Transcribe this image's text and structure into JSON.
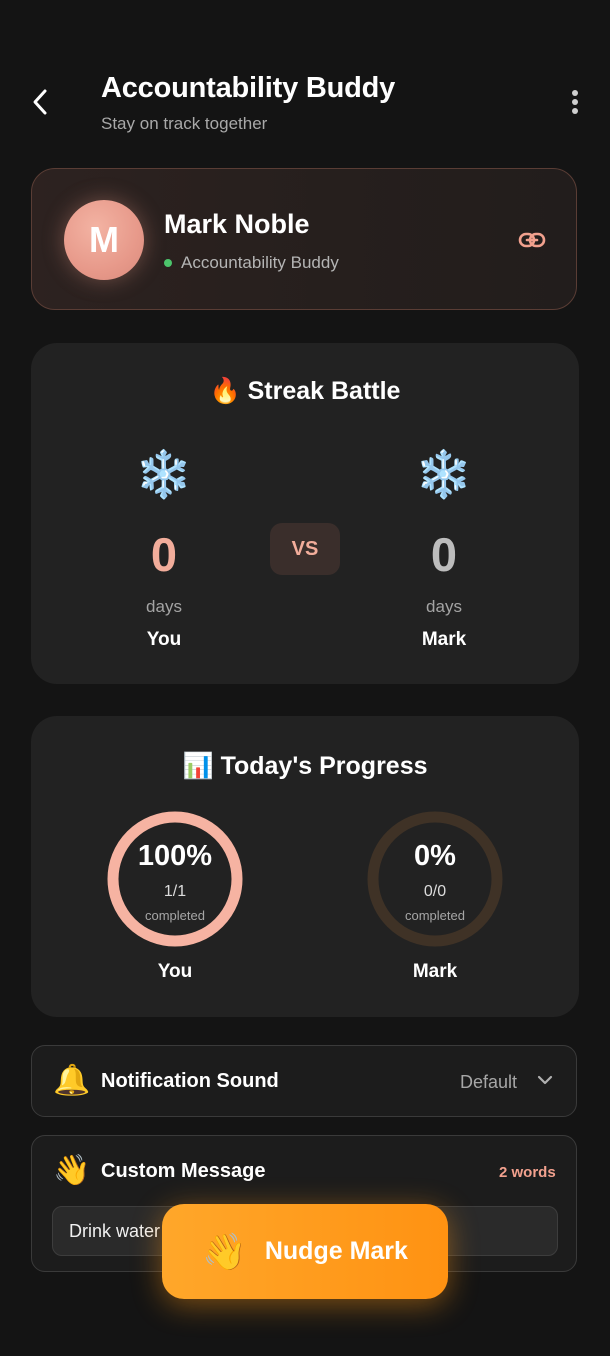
{
  "header": {
    "title": "Accountability Buddy",
    "subtitle": "Stay on track together",
    "back_icon": "chevron-left-icon",
    "menu_icon": "more-vertical-icon"
  },
  "buddy": {
    "initial": "M",
    "name": "Mark Noble",
    "role": "Accountability Buddy",
    "status_color": "#4cc46b",
    "link_icon": "link-icon"
  },
  "streak": {
    "emoji": "🔥",
    "title": "Streak Battle",
    "vs_label": "VS",
    "you": {
      "icon": "❄️",
      "count": "0",
      "unit": "days",
      "label": "You",
      "color": "#f2ad9b"
    },
    "buddy": {
      "icon": "❄️",
      "count": "0",
      "unit": "days",
      "label": "Mark",
      "color": "#bdbdbd"
    }
  },
  "progress": {
    "emoji": "📊",
    "title": "Today's Progress",
    "you": {
      "percent_label": "100%",
      "fraction": "1/1",
      "caption": "completed",
      "label": "You",
      "fill": 1.0,
      "ring_color": "#f6b3a2"
    },
    "buddy": {
      "percent_label": "0%",
      "fraction": "0/0",
      "caption": "completed",
      "label": "Mark",
      "fill": 0.0,
      "ring_color": "#3f3226"
    }
  },
  "notification": {
    "icon": "🔔",
    "label": "Notification Sound",
    "value": "Default"
  },
  "custom_message": {
    "icon": "👋",
    "label": "Custom Message",
    "word_count": "2 words",
    "value": "Drink water"
  },
  "nudge": {
    "emoji": "👋",
    "label": "Nudge Mark"
  },
  "colors": {
    "background": "#141414",
    "card": "#222222",
    "accent": "#ff9a1f",
    "peach": "#f2ad9b"
  }
}
